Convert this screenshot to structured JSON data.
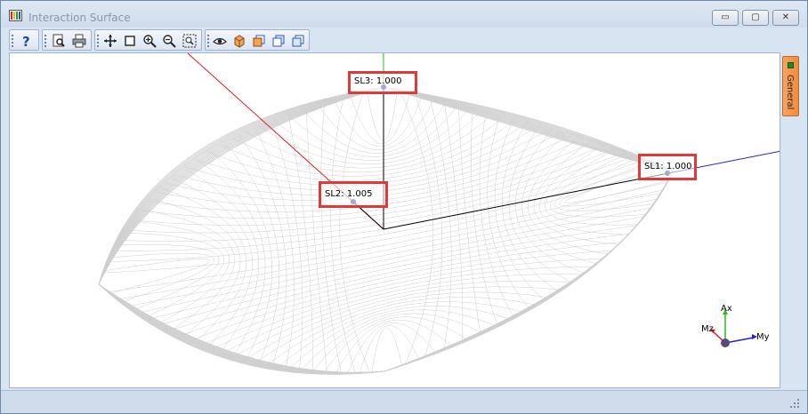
{
  "window": {
    "title": "Interaction Surface",
    "minimize_symbol": "▭",
    "maximize_symbol": "▢",
    "close_symbol": "✕"
  },
  "toolbar": {
    "buttons": [
      {
        "icon": "help-icon"
      },
      {
        "icon": "print-preview-icon"
      },
      {
        "icon": "print-icon"
      },
      {
        "icon": "pan-icon"
      },
      {
        "icon": "select-box-icon"
      },
      {
        "icon": "zoom-in-icon"
      },
      {
        "icon": "zoom-out-icon"
      },
      {
        "icon": "zoom-extents-icon"
      },
      {
        "icon": "eye-icon"
      },
      {
        "icon": "view-3d-icon"
      },
      {
        "icon": "view-front-icon"
      },
      {
        "icon": "view-side-icon"
      },
      {
        "icon": "view-top-icon"
      }
    ]
  },
  "callouts": {
    "sl3": {
      "label": "SL3:",
      "value": "1.000"
    },
    "sl2": {
      "label": "SL2:",
      "value": "1.005"
    },
    "sl1": {
      "label": "SL1:",
      "value": "1.000"
    }
  },
  "triad": {
    "ax": "Ax",
    "my": "My",
    "mz": "Mz"
  },
  "side_panel": {
    "tab_label": "General"
  },
  "colors": {
    "callout_border": "#e0393a",
    "axis_red": "#e02020",
    "axis_green": "#20c020",
    "axis_blue": "#2020d0",
    "mesh": "#cfcfcf",
    "accent": "#f08c3b"
  }
}
